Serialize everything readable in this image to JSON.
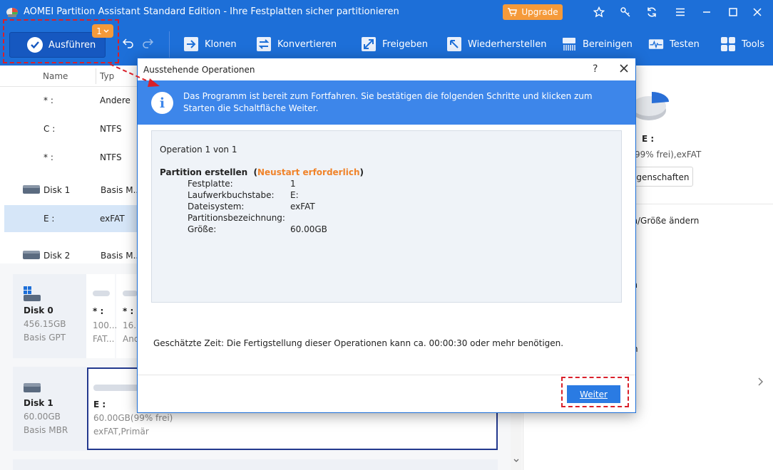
{
  "window": {
    "title": "AOMEI Partition Assistant Standard Edition - Ihre Festplatten sicher partitionieren",
    "upgrade_label": "Upgrade"
  },
  "toolbar": {
    "execute_label": "Ausführen",
    "pending_count": "1",
    "items": [
      {
        "label": "Klonen",
        "icon": "clone-icon"
      },
      {
        "label": "Konvertieren",
        "icon": "convert-icon"
      },
      {
        "label": "Freigeben",
        "icon": "free-icon"
      },
      {
        "label": "Wiederherstellen",
        "icon": "restore-icon"
      },
      {
        "label": "Bereinigen",
        "icon": "wipe-icon"
      },
      {
        "label": "Testen",
        "icon": "test-icon"
      },
      {
        "label": "Tools",
        "icon": "tools-icon"
      }
    ]
  },
  "disk_list": {
    "headers": {
      "name": "Name",
      "type": "Typ"
    },
    "rows": [
      {
        "name": "* :",
        "type": "Andere"
      },
      {
        "name": "C :",
        "type": "NTFS"
      },
      {
        "name": "* :",
        "type": "NTFS"
      },
      {
        "name": "Disk 1",
        "type": "Basis M.."
      },
      {
        "name": "E :",
        "type": "exFAT"
      },
      {
        "name": "Disk 2",
        "type": "Basis M.."
      }
    ]
  },
  "disk_map": {
    "disk0": {
      "name": "Disk 0",
      "size": "456.15GB",
      "style": "Basis GPT",
      "parts": [
        {
          "name": "* :",
          "line1": "100....",
          "line2": "FAT..."
        },
        {
          "name": "* :",
          "line1": "16.0...",
          "line2": "And..."
        }
      ]
    },
    "disk1": {
      "name": "Disk 1",
      "size": "60.00GB",
      "style": "Basis MBR",
      "part": {
        "name": "E :",
        "line1": "60.00GB(99% frei)",
        "line2": "exFAT,Primär"
      }
    }
  },
  "right_panel": {
    "drive": "E :",
    "detail": "99% frei),exFAT",
    "properties_btn": "igenschaften",
    "actions": [
      "en/Größe ändern",
      "en",
      "n"
    ]
  },
  "dialog": {
    "title": "Ausstehende Operationen",
    "help": "?",
    "info_text": "Das Programm ist bereit zum Fortfahren. Sie bestätigen die folgenden Schritte und klicken zum Starten die Schaltfläche Weiter.",
    "operation_count": "Operation 1 von 1",
    "operation_title": "Partition erstellen",
    "restart_note": "Neustart erforderlich",
    "details": [
      {
        "label": "Festplatte:",
        "value": "1"
      },
      {
        "label": "Laufwerkbuchstabe:",
        "value": "E:"
      },
      {
        "label": "Dateisystem:",
        "value": "exFAT"
      },
      {
        "label": "Partitionsbezeichnung:",
        "value": ""
      },
      {
        "label": "Größe:",
        "value": "60.00GB"
      }
    ],
    "estimated_time": "Geschätzte Zeit: Die Fertigstellung dieser Operationen kann ca. 00:00:30 oder mehr benötigen.",
    "next_label": "Weiter"
  },
  "colors": {
    "brand_blue": "#1d6fd8",
    "info_blue": "#3d86ea",
    "accent_orange": "#f59a3a",
    "highlight_red": "#d9202a"
  }
}
